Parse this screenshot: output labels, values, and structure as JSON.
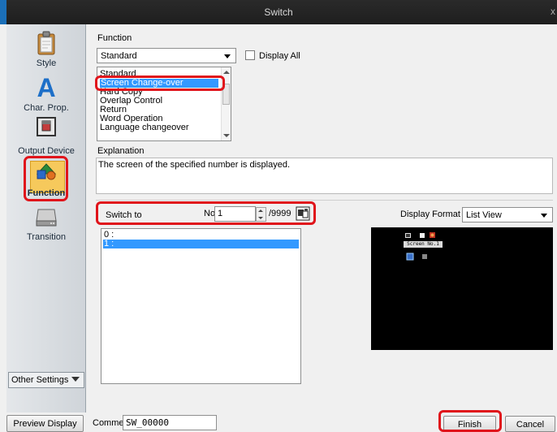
{
  "window": {
    "title": "Switch",
    "close": "x"
  },
  "sidebar": {
    "items": [
      {
        "label": "Style",
        "icon": "clipboard-icon"
      },
      {
        "label": "Char. Prop.",
        "icon": "letter-a-icon"
      },
      {
        "label": "Output Device",
        "icon": "output-device-icon"
      },
      {
        "label": "Function",
        "icon": "shapes-icon",
        "selected": true
      },
      {
        "label": "Transition",
        "icon": "drive-icon"
      }
    ],
    "other_settings": "Other Settings"
  },
  "function": {
    "label": "Function",
    "combo_value": "Standard",
    "display_all_label": "Display All",
    "display_all_checked": false,
    "list_items": [
      "Standard",
      "Screen Change-over",
      "Hard Copy",
      "Overlap Control",
      "Return",
      "Word Operation",
      "Language changeover"
    ],
    "selected_item": "Screen Change-over"
  },
  "explanation": {
    "label": "Explanation",
    "text": "The screen of the specified number is displayed."
  },
  "switch_to": {
    "label": "Switch to",
    "no_label": "No",
    "value": "1",
    "max": "/9999",
    "list": [
      "0 :",
      "1 :"
    ],
    "selected_index": 1
  },
  "display_format": {
    "label": "Display Format",
    "value": "List View"
  },
  "preview": {
    "caption": "Screen No.1"
  },
  "footer": {
    "preview_display": "Preview Display",
    "comment_label": "Comme",
    "comment_value": "SW_00000",
    "finish": "Finish",
    "cancel": "Cancel"
  },
  "colors": {
    "highlight_red": "#e0141b",
    "selection_blue": "#3399ff",
    "function_icon_bg": "#f6c95c"
  }
}
